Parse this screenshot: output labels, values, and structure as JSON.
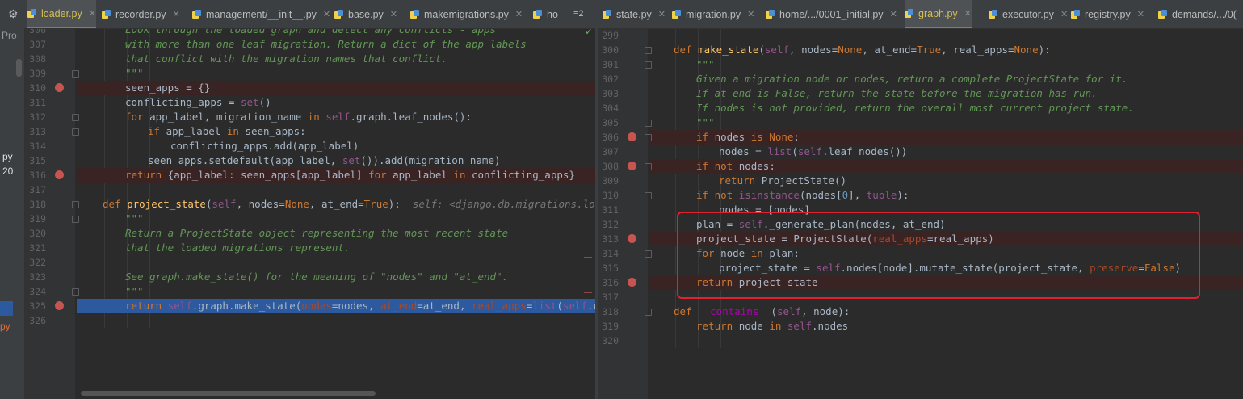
{
  "left_tabs": [
    {
      "label": "loader.py",
      "active": true
    },
    {
      "label": "recorder.py"
    },
    {
      "label": "management/__init__.py"
    },
    {
      "label": "base.py"
    },
    {
      "label": "makemigrations.py"
    },
    {
      "label": "ho"
    }
  ],
  "left_overflow": "≡2",
  "right_tabs": [
    {
      "label": "state.py"
    },
    {
      "label": "migration.py"
    },
    {
      "label": "home/.../0001_initial.py"
    },
    {
      "label": "graph.py",
      "active": true
    },
    {
      "label": "executor.py"
    },
    {
      "label": "registry.py"
    },
    {
      "label": "demands/.../0("
    }
  ],
  "strip": {
    "top": "Pro",
    "mid1": "py",
    "mid2": "20",
    "bottom": "py"
  },
  "left_code": [
    {
      "n": "306",
      "t": [
        [
          "doc",
          "Look through the loaded graph and detect any conflicts - apps"
        ]
      ],
      "i": 2
    },
    {
      "n": "307",
      "t": [
        [
          "doc",
          "with more than one leaf migration. Return a dict of the app labels"
        ]
      ],
      "i": 2
    },
    {
      "n": "308",
      "t": [
        [
          "doc",
          "that conflict with the migration names that conflict."
        ]
      ],
      "i": 2
    },
    {
      "n": "309",
      "t": [
        [
          "doc",
          "\"\"\""
        ]
      ],
      "i": 2
    },
    {
      "n": "310",
      "bp": true,
      "t": [
        [
          "",
          "seen_apps = {}"
        ]
      ],
      "i": 2
    },
    {
      "n": "311",
      "t": [
        [
          "",
          "conflicting_apps = "
        ],
        [
          "self",
          "set"
        ],
        [
          "",
          "()"
        ]
      ],
      "i": 2
    },
    {
      "n": "312",
      "t": [
        [
          "kw",
          "for "
        ],
        [
          "",
          "app_label, migration_name "
        ],
        [
          "kw",
          "in "
        ],
        [
          "self",
          "self"
        ],
        [
          "",
          ".graph.leaf_nodes():"
        ]
      ],
      "i": 2
    },
    {
      "n": "313",
      "t": [
        [
          "kw",
          "if "
        ],
        [
          "",
          "app_label "
        ],
        [
          "kw",
          "in "
        ],
        [
          "",
          "seen_apps:"
        ]
      ],
      "i": 3
    },
    {
      "n": "314",
      "t": [
        [
          "",
          "conflicting_apps.add(app_label)"
        ]
      ],
      "i": 4
    },
    {
      "n": "315",
      "t": [
        [
          "",
          "seen_apps.setdefault(app_label, "
        ],
        [
          "self",
          "set"
        ],
        [
          "",
          "()).add(migration_name)"
        ]
      ],
      "i": 3
    },
    {
      "n": "316",
      "bp": true,
      "t": [
        [
          "kw",
          "return "
        ],
        [
          "",
          "{app_label: seen_apps[app_label] "
        ],
        [
          "kw",
          "for "
        ],
        [
          "",
          "app_label "
        ],
        [
          "kw",
          "in "
        ],
        [
          "",
          "conflicting_apps}"
        ]
      ],
      "i": 2
    },
    {
      "n": "317",
      "t": [],
      "i": 0
    },
    {
      "n": "318",
      "t": [
        [
          "kw",
          "def "
        ],
        [
          "fn",
          "project_state"
        ],
        [
          "",
          "("
        ],
        [
          "self",
          "self"
        ],
        [
          "",
          ", nodes="
        ],
        [
          "kw",
          "None"
        ],
        [
          "",
          ", at_end="
        ],
        [
          "kw",
          "True"
        ],
        [
          "",
          "):  "
        ],
        [
          "hint",
          "self: <django.db.migrations.loader.M"
        ]
      ],
      "i": 1
    },
    {
      "n": "319",
      "t": [
        [
          "doc",
          "\"\"\""
        ]
      ],
      "i": 2
    },
    {
      "n": "320",
      "t": [
        [
          "doc",
          "Return a ProjectState object representing the most recent state"
        ]
      ],
      "i": 2
    },
    {
      "n": "321",
      "t": [
        [
          "doc",
          "that the loaded migrations represent."
        ]
      ],
      "i": 2
    },
    {
      "n": "322",
      "t": [],
      "i": 0
    },
    {
      "n": "323",
      "t": [
        [
          "doc",
          "See graph.make_state() for the meaning of \"nodes\" and \"at_end\"."
        ]
      ],
      "i": 2
    },
    {
      "n": "324",
      "t": [
        [
          "doc",
          "\"\"\""
        ]
      ],
      "i": 2
    },
    {
      "n": "325",
      "bp": true,
      "cur": true,
      "t": [
        [
          "kw",
          "return "
        ],
        [
          "self",
          "self"
        ],
        [
          "",
          ".graph.make_state("
        ],
        [
          "par",
          "nodes"
        ],
        [
          "",
          "=nodes, "
        ],
        [
          "par",
          "at_end"
        ],
        [
          "",
          "=at_end, "
        ],
        [
          "par",
          "real_apps"
        ],
        [
          "",
          "="
        ],
        [
          "self",
          "list"
        ],
        [
          "",
          "("
        ],
        [
          "self",
          "self"
        ],
        [
          "",
          ".unmigra"
        ]
      ],
      "i": 2
    },
    {
      "n": "326",
      "t": [],
      "i": 0
    }
  ],
  "right_code": [
    {
      "n": "299",
      "t": [],
      "i": 0
    },
    {
      "n": "300",
      "t": [
        [
          "kw",
          "def "
        ],
        [
          "fn",
          "make_state"
        ],
        [
          "",
          "("
        ],
        [
          "self",
          "self"
        ],
        [
          "",
          ", nodes="
        ],
        [
          "kw",
          "None"
        ],
        [
          "",
          ", at_end="
        ],
        [
          "kw",
          "True"
        ],
        [
          "",
          ", real_apps="
        ],
        [
          "kw",
          "None"
        ],
        [
          "",
          "):"
        ]
      ],
      "i": 1
    },
    {
      "n": "301",
      "t": [
        [
          "doc",
          "\"\"\""
        ]
      ],
      "i": 2
    },
    {
      "n": "302",
      "t": [
        [
          "doc",
          "Given a migration node or nodes, return a complete ProjectState for it."
        ]
      ],
      "i": 2
    },
    {
      "n": "303",
      "t": [
        [
          "doc",
          "If at_end is False, return the state before the migration has run."
        ]
      ],
      "i": 2
    },
    {
      "n": "304",
      "t": [
        [
          "doc",
          "If nodes is not provided, return the overall most current project state."
        ]
      ],
      "i": 2
    },
    {
      "n": "305",
      "t": [
        [
          "doc",
          "\"\"\""
        ]
      ],
      "i": 2
    },
    {
      "n": "306",
      "bp": true,
      "t": [
        [
          "kw",
          "if "
        ],
        [
          "",
          "nodes "
        ],
        [
          "kw",
          "is None"
        ],
        [
          "",
          ":"
        ]
      ],
      "i": 2
    },
    {
      "n": "307",
      "t": [
        [
          "",
          "nodes = "
        ],
        [
          "self",
          "list"
        ],
        [
          "",
          "("
        ],
        [
          "self",
          "self"
        ],
        [
          "",
          ".leaf_nodes())"
        ]
      ],
      "i": 3
    },
    {
      "n": "308",
      "bp": true,
      "t": [
        [
          "kw",
          "if not "
        ],
        [
          "",
          "nodes:"
        ]
      ],
      "i": 2
    },
    {
      "n": "309",
      "t": [
        [
          "kw",
          "return "
        ],
        [
          "",
          "ProjectState()"
        ]
      ],
      "i": 3
    },
    {
      "n": "310",
      "t": [
        [
          "kw",
          "if not "
        ],
        [
          "self",
          "isinstance"
        ],
        [
          "",
          "(nodes["
        ],
        [
          "num",
          "0"
        ],
        [
          "",
          "], "
        ],
        [
          "self",
          "tuple"
        ],
        [
          "",
          "):"
        ]
      ],
      "i": 2
    },
    {
      "n": "311",
      "t": [
        [
          "",
          "nodes = [nodes]"
        ]
      ],
      "i": 3
    },
    {
      "n": "312",
      "t": [
        [
          "",
          "plan = "
        ],
        [
          "self",
          "self"
        ],
        [
          "",
          "._generate_plan(nodes, at_end)"
        ]
      ],
      "i": 2
    },
    {
      "n": "313",
      "bp": true,
      "t": [
        [
          "",
          "project_state = ProjectState("
        ],
        [
          "par",
          "real_apps"
        ],
        [
          "",
          "=real_apps)"
        ]
      ],
      "i": 2
    },
    {
      "n": "314",
      "t": [
        [
          "kw",
          "for "
        ],
        [
          "",
          "node "
        ],
        [
          "kw",
          "in "
        ],
        [
          "",
          "plan:"
        ]
      ],
      "i": 2
    },
    {
      "n": "315",
      "t": [
        [
          "",
          "project_state = "
        ],
        [
          "self",
          "self"
        ],
        [
          "",
          ".nodes[node].mutate_state(project_state, "
        ],
        [
          "par",
          "preserve"
        ],
        [
          "",
          "="
        ],
        [
          "kw",
          "False"
        ],
        [
          "",
          ")"
        ]
      ],
      "i": 3
    },
    {
      "n": "316",
      "bp": true,
      "t": [
        [
          "kw",
          "return "
        ],
        [
          "",
          "project_state"
        ]
      ],
      "i": 2
    },
    {
      "n": "317",
      "t": [],
      "i": 0
    },
    {
      "n": "318",
      "t": [
        [
          "kw",
          "def "
        ],
        [
          "mag",
          "__contains__"
        ],
        [
          "",
          "("
        ],
        [
          "self",
          "self"
        ],
        [
          "",
          ", node):"
        ]
      ],
      "i": 1
    },
    {
      "n": "319",
      "t": [
        [
          "kw",
          "return "
        ],
        [
          "",
          "node "
        ],
        [
          "kw",
          "in "
        ],
        [
          "self",
          "self"
        ],
        [
          "",
          ".nodes"
        ]
      ],
      "i": 2
    },
    {
      "n": "320",
      "t": [],
      "i": 0
    }
  ]
}
